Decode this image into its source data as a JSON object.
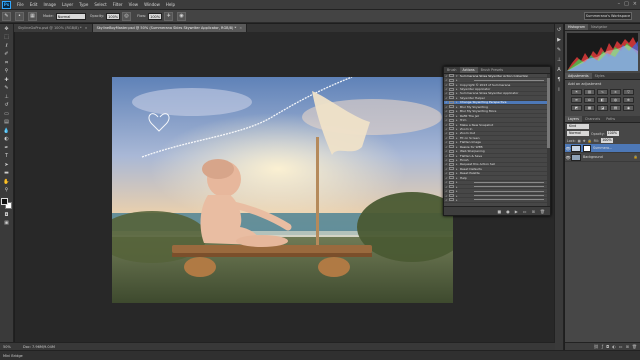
{
  "menu": {
    "items": [
      "File",
      "Edit",
      "Image",
      "Layer",
      "Type",
      "Select",
      "Filter",
      "View",
      "Window",
      "Help"
    ]
  },
  "options": {
    "mode_label": "Mode:",
    "mode_value": "Normal",
    "opacity_label": "Opacity:",
    "opacity_value": "100%",
    "flow_label": "Flow:",
    "flow_value": "100%",
    "workspace": "Summerana's Workspace"
  },
  "tabs": [
    {
      "label": "SkylineGoPro.psd @ 100% (RGB/8) *"
    },
    {
      "label": "SkylineBoyMaster.psd @ 50% (Summerana Skies Skywriter Applicator, RGB/8) *"
    }
  ],
  "status": {
    "zoom": "50%",
    "doc": "Doc: 7.96M/9.04M",
    "mini_bridge": "Mini Bridge"
  },
  "actions_panel": {
    "tabs": [
      "Brush",
      "Actions",
      "Brush Presets"
    ],
    "rows": [
      {
        "label": "Summerana Skies Skywriter Action Collection",
        "type": "set"
      },
      {
        "label": "",
        "type": "line"
      },
      {
        "label": "Copyright © 2013 of Summerana",
        "type": "item"
      },
      {
        "label": "Skywriter Applicator",
        "type": "item"
      },
      {
        "label": "Summerana Skies Skywriter Applicator",
        "type": "item"
      },
      {
        "label": "Skywriter Helper",
        "type": "item"
      },
      {
        "label": "Change Skywriting Perspective",
        "type": "selected"
      },
      {
        "label": "Blur My Skywriting",
        "type": "item"
      },
      {
        "label": "Blur My Skywriting More",
        "type": "item"
      },
      {
        "label": "Refill The Jet",
        "type": "item"
      },
      {
        "label": "Trim",
        "type": "item"
      },
      {
        "label": "Make a New Snapshot",
        "type": "item"
      },
      {
        "label": "Zoom In",
        "type": "item"
      },
      {
        "label": "Zoom Out",
        "type": "item"
      },
      {
        "label": "Fit on Screen",
        "type": "item"
      },
      {
        "label": "Flatten Image",
        "type": "item"
      },
      {
        "label": "Resize for WEB",
        "type": "item"
      },
      {
        "label": "Web Sharpening",
        "type": "item"
      },
      {
        "label": "Flatten & Save",
        "type": "item"
      },
      {
        "label": "Finish",
        "type": "item"
      },
      {
        "label": "Request this Action Set",
        "type": "item"
      },
      {
        "label": "Reset Defaults",
        "type": "item"
      },
      {
        "label": "Reset Palette",
        "type": "item"
      },
      {
        "label": "Help",
        "type": "item"
      },
      {
        "label": "",
        "type": "line"
      },
      {
        "label": "",
        "type": "line"
      },
      {
        "label": "",
        "type": "line"
      },
      {
        "label": "",
        "type": "line"
      },
      {
        "label": "",
        "type": "line"
      }
    ]
  },
  "right": {
    "histogram_tab": "Histogram",
    "navigator_tab": "Navigator",
    "adjustments_tab": "Adjustments",
    "styles_tab": "Styles",
    "adjustments_title": "Add an adjustment",
    "layers_tab": "Layers",
    "channels_tab": "Channels",
    "paths_tab": "Paths",
    "kind_label": "Kind",
    "blend_value": "Normal",
    "opacity_label": "Opacity:",
    "opacity_value": "100%",
    "lock_label": "Lock:",
    "fill_label": "Fill:",
    "fill_value": "100%",
    "layers": [
      {
        "name": "Summera...",
        "selected": true
      },
      {
        "name": "Background",
        "selected": false
      }
    ]
  },
  "colors": {
    "accent": "#4d78b7",
    "ps_blue": "#31a8ff"
  }
}
